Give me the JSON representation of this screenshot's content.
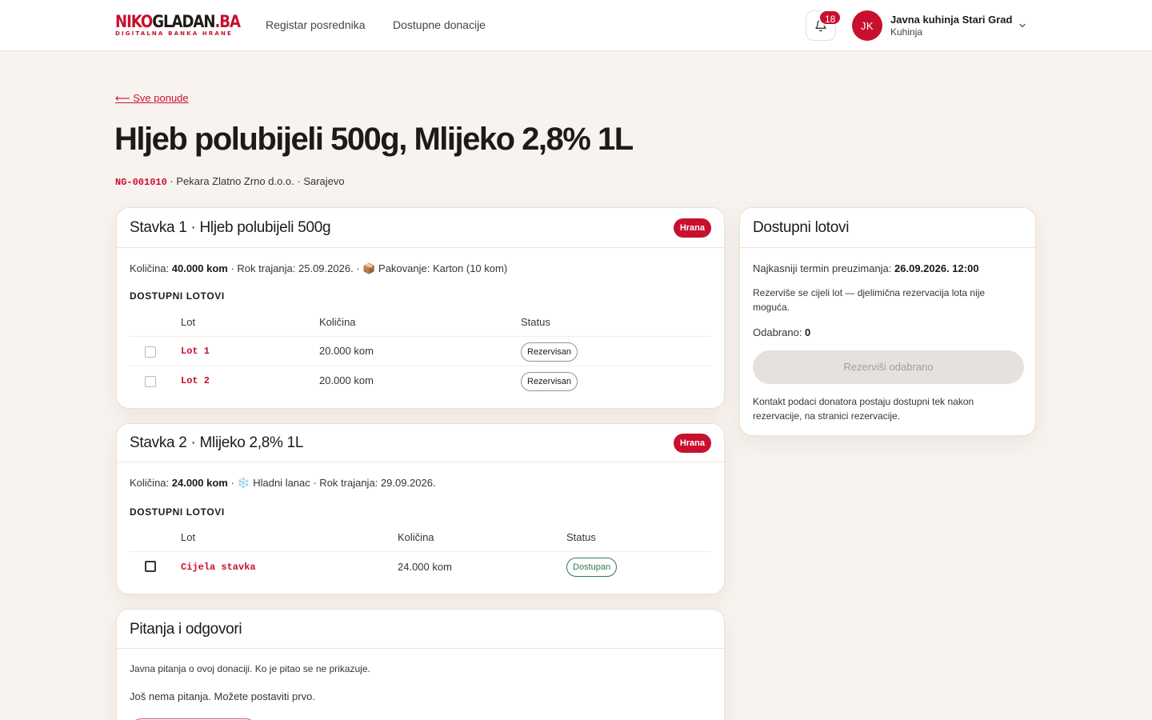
{
  "header": {
    "logo_main_red": "NIKO",
    "logo_main_dark": "GLADAN",
    "logo_main_tail": ".BA",
    "logo_sub": "DIGITALNA BANKA HRANE",
    "nav": [
      {
        "label": "Registar posrednika"
      },
      {
        "label": "Dostupne donacije"
      }
    ],
    "notifications_count": "18",
    "user": {
      "initials": "JK",
      "name": "Javna kuhinja Stari Grad",
      "role": "Kuhinja"
    }
  },
  "page": {
    "back_link": "⟵ Sve ponude",
    "title": "Hljeb polubijeli 500g, Mlijeko 2,8% 1L",
    "code": "NG-001010",
    "meta_rest": " · Pekara Zlatno Zrno d.o.o. · Sarajevo"
  },
  "items": [
    {
      "title": "Stavka 1 · Hljeb polubijeli 500g",
      "tag": "Hrana",
      "info_prefix": "Količina: ",
      "info_qty": "40.000 kom",
      "info_rest": " · Rok trajanja: 25.09.2026. · 📦 Pakovanje: Karton (10 kom)",
      "section_label": "DOSTUPNI LOTOVI",
      "headers": {
        "lot": "Lot",
        "qty": "Količina",
        "status": "Status"
      },
      "lots": [
        {
          "name": "Lot 1",
          "qty": "20.000 kom",
          "status": "Rezervisan"
        },
        {
          "name": "Lot 2",
          "qty": "20.000 kom",
          "status": "Rezervisan"
        }
      ]
    },
    {
      "title": "Stavka 2 · Mlijeko 2,8% 1L",
      "tag": "Hrana",
      "info_prefix": "Količina: ",
      "info_qty": "24.000 kom",
      "info_rest": " · ❄️ Hladni lanac · Rok trajanja: 29.09.2026.",
      "section_label": "DOSTUPNI LOTOVI",
      "headers": {
        "lot": "Lot",
        "qty": "Količina",
        "status": "Status"
      },
      "lots": [
        {
          "name": "Cijela stavka",
          "qty": "24.000 kom",
          "status": "Dostupan"
        }
      ]
    }
  ],
  "qa": {
    "title": "Pitanja i odgovori",
    "intro": "Javna pitanja o ovoj donaciji. Ko je pitao se ne prikazuje.",
    "empty": "Još nema pitanja. Možete postaviti prvo."
  },
  "sidebar": {
    "title": "Dostupni lotovi",
    "deadline_label": "Najkasniji termin preuzimanja: ",
    "deadline_value": "26.09.2026. 12:00",
    "note": "Rezerviše se cijeli lot — djelimična rezervacija lota nije moguća.",
    "selected_label": "Odabrano: ",
    "selected_value": "0",
    "reserve_button": "Rezerviši odabrano",
    "contact_note": "Kontakt podaci donatora postaju dostupni tek nakon rezervacije, na stranici rezervacije."
  },
  "colors": {
    "brand": "#c8102e",
    "available": "#2f7a4f",
    "background": "#f8f3ef"
  }
}
